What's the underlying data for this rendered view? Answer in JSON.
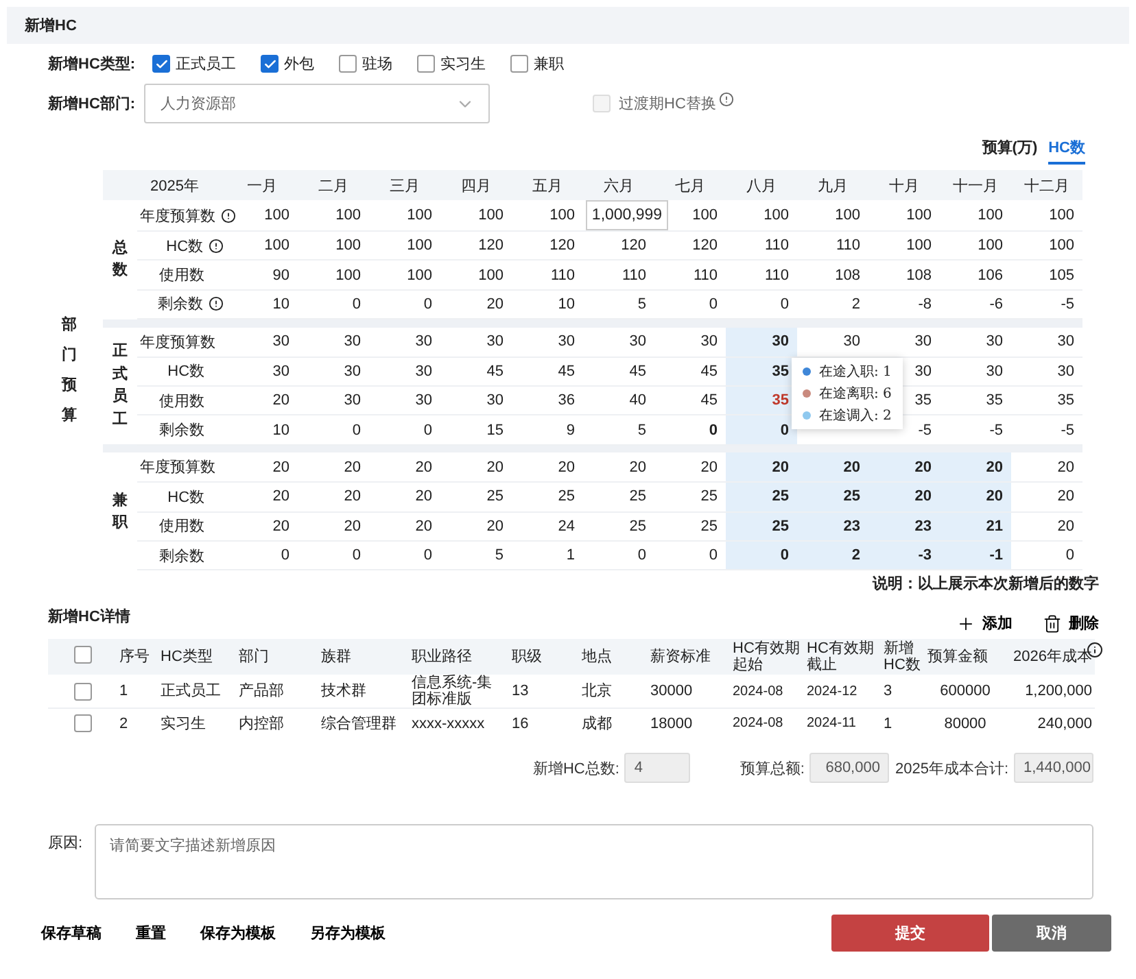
{
  "header": {
    "title": "新增HC"
  },
  "hc_type": {
    "label": "新增HC类型:",
    "options": [
      {
        "label": "正式员工",
        "checked": true
      },
      {
        "label": "外包",
        "checked": true
      },
      {
        "label": "驻场",
        "checked": false
      },
      {
        "label": "实习生",
        "checked": false
      },
      {
        "label": "兼职",
        "checked": false
      }
    ]
  },
  "department": {
    "label": "新增HC部门:",
    "value": "人力资源部",
    "transition": {
      "label": "过渡期HC替换",
      "checked": false,
      "disabled": true
    }
  },
  "view_toggle": [
    {
      "label": "预算(万)",
      "selected": false
    },
    {
      "label": "HC数",
      "selected": true
    }
  ],
  "budget_table": {
    "section_label": "部门预算",
    "year": "2025年",
    "months": [
      "一月",
      "二月",
      "三月",
      "四月",
      "五月",
      "六月",
      "七月",
      "八月",
      "九月",
      "十月",
      "十一月",
      "十二月"
    ],
    "groups": [
      {
        "name": "总数",
        "rows": [
          {
            "label": "年度预算数",
            "info": true,
            "cells": [
              {
                "text": "100",
                "kind": "plain"
              },
              {
                "text": "100",
                "kind": "plain"
              },
              {
                "text": "100",
                "kind": "plain"
              },
              {
                "text": "100",
                "kind": "plain"
              },
              {
                "text": "100",
                "kind": "plain"
              },
              {
                "text": "1,000,999",
                "kind": "input"
              },
              {
                "text": "100",
                "kind": "plain"
              },
              {
                "text": "100",
                "kind": "plain"
              },
              {
                "text": "100",
                "kind": "plain"
              },
              {
                "text": "100",
                "kind": "plain"
              },
              {
                "text": "100",
                "kind": "plain"
              },
              {
                "text": "100",
                "kind": "plain"
              }
            ]
          },
          {
            "label": "HC数",
            "info": true,
            "cells": [
              {
                "text": "100",
                "kind": "plain"
              },
              {
                "text": "100",
                "kind": "plain"
              },
              {
                "text": "100",
                "kind": "plain"
              },
              {
                "text": "120",
                "kind": "plain"
              },
              {
                "text": "120",
                "kind": "plain"
              },
              {
                "text": "120",
                "kind": "plain"
              },
              {
                "text": "120",
                "kind": "plain"
              },
              {
                "text": "110",
                "kind": "plain"
              },
              {
                "text": "110",
                "kind": "plain"
              },
              {
                "text": "100",
                "kind": "plain"
              },
              {
                "text": "100",
                "kind": "plain"
              },
              {
                "text": "100",
                "kind": "plain"
              }
            ]
          },
          {
            "label": "使用数",
            "info": false,
            "cells": [
              {
                "text": "90",
                "kind": "plain"
              },
              {
                "text": "100",
                "kind": "plain"
              },
              {
                "text": "100",
                "kind": "plain"
              },
              {
                "text": "100",
                "kind": "plain"
              },
              {
                "text": "110",
                "kind": "plain"
              },
              {
                "text": "110",
                "kind": "plain"
              },
              {
                "text": "110",
                "kind": "plain"
              },
              {
                "text": "110",
                "kind": "plain"
              },
              {
                "text": "108",
                "kind": "plain"
              },
              {
                "text": "108",
                "kind": "plain"
              },
              {
                "text": "106",
                "kind": "plain"
              },
              {
                "text": "105",
                "kind": "plain"
              }
            ]
          },
          {
            "label": "剩余数",
            "info": true,
            "cells": [
              {
                "text": "10",
                "kind": "plain"
              },
              {
                "text": "0",
                "kind": "plain"
              },
              {
                "text": "0",
                "kind": "plain"
              },
              {
                "text": "20",
                "kind": "plain"
              },
              {
                "text": "10",
                "kind": "plain"
              },
              {
                "text": "5",
                "kind": "plain"
              },
              {
                "text": "0",
                "kind": "plain"
              },
              {
                "text": "0",
                "kind": "plain"
              },
              {
                "text": "2",
                "kind": "plain"
              },
              {
                "text": "-8",
                "kind": "plain"
              },
              {
                "text": "-6",
                "kind": "plain"
              },
              {
                "text": "-5",
                "kind": "plain"
              }
            ]
          }
        ]
      },
      {
        "name": "正式员工",
        "rows": [
          {
            "label": "年度预算数",
            "info": false,
            "cells": [
              {
                "text": "30",
                "kind": "plain"
              },
              {
                "text": "30",
                "kind": "plain"
              },
              {
                "text": "30",
                "kind": "plain"
              },
              {
                "text": "30",
                "kind": "plain"
              },
              {
                "text": "30",
                "kind": "plain"
              },
              {
                "text": "30",
                "kind": "plain"
              },
              {
                "text": "30",
                "kind": "plain"
              },
              {
                "text": "30",
                "kind": "highlight"
              },
              {
                "text": "30",
                "kind": "plain"
              },
              {
                "text": "30",
                "kind": "plain"
              },
              {
                "text": "30",
                "kind": "plain"
              },
              {
                "text": "30",
                "kind": "plain"
              }
            ]
          },
          {
            "label": "HC数",
            "info": false,
            "cells": [
              {
                "text": "30",
                "kind": "plain"
              },
              {
                "text": "30",
                "kind": "plain"
              },
              {
                "text": "30",
                "kind": "plain"
              },
              {
                "text": "45",
                "kind": "plain"
              },
              {
                "text": "45",
                "kind": "plain"
              },
              {
                "text": "45",
                "kind": "plain"
              },
              {
                "text": "45",
                "kind": "plain"
              },
              {
                "text": "35",
                "kind": "highlight"
              },
              null,
              {
                "text": "30",
                "kind": "plain"
              },
              {
                "text": "30",
                "kind": "plain"
              },
              {
                "text": "30",
                "kind": "plain"
              }
            ]
          },
          {
            "label": "使用数",
            "info": false,
            "cells": [
              {
                "text": "20",
                "kind": "plain"
              },
              {
                "text": "30",
                "kind": "plain"
              },
              {
                "text": "30",
                "kind": "plain"
              },
              {
                "text": "30",
                "kind": "plain"
              },
              {
                "text": "36",
                "kind": "plain"
              },
              {
                "text": "40",
                "kind": "plain"
              },
              {
                "text": "45",
                "kind": "plain"
              },
              {
                "text": "35",
                "kind": "alert"
              },
              null,
              {
                "text": "35",
                "kind": "plain"
              },
              {
                "text": "35",
                "kind": "plain"
              },
              {
                "text": "35",
                "kind": "plain"
              }
            ]
          },
          {
            "label": "剩余数",
            "info": false,
            "cells": [
              {
                "text": "10",
                "kind": "plain"
              },
              {
                "text": "0",
                "kind": "plain"
              },
              {
                "text": "0",
                "kind": "plain"
              },
              {
                "text": "15",
                "kind": "plain"
              },
              {
                "text": "9",
                "kind": "plain"
              },
              {
                "text": "5",
                "kind": "plain"
              },
              {
                "text": "0",
                "kind": "bold"
              },
              {
                "text": "0",
                "kind": "highlight"
              },
              null,
              {
                "text": "-5",
                "kind": "plain"
              },
              {
                "text": "-5",
                "kind": "plain"
              },
              {
                "text": "-5",
                "kind": "plain"
              }
            ]
          }
        ],
        "popup": [
          {
            "label": "在途入职: 1",
            "color": "#3f87d8"
          },
          {
            "label": "在途离职: 6",
            "color": "#c98a7e"
          },
          {
            "label": "在途调入: 2",
            "color": "#8fc9ef"
          }
        ]
      },
      {
        "name": "兼职",
        "rows": [
          {
            "label": "年度预算数",
            "info": false,
            "cells": [
              {
                "text": "20",
                "kind": "plain"
              },
              {
                "text": "20",
                "kind": "plain"
              },
              {
                "text": "20",
                "kind": "plain"
              },
              {
                "text": "20",
                "kind": "plain"
              },
              {
                "text": "20",
                "kind": "plain"
              },
              {
                "text": "20",
                "kind": "plain"
              },
              {
                "text": "20",
                "kind": "plain"
              },
              {
                "text": "20",
                "kind": "highlight"
              },
              {
                "text": "20",
                "kind": "highlight"
              },
              {
                "text": "20",
                "kind": "highlight"
              },
              {
                "text": "20",
                "kind": "highlight"
              },
              {
                "text": "20",
                "kind": "plain"
              }
            ]
          },
          {
            "label": "HC数",
            "info": false,
            "cells": [
              {
                "text": "20",
                "kind": "plain"
              },
              {
                "text": "20",
                "kind": "plain"
              },
              {
                "text": "20",
                "kind": "plain"
              },
              {
                "text": "25",
                "kind": "plain"
              },
              {
                "text": "25",
                "kind": "plain"
              },
              {
                "text": "25",
                "kind": "plain"
              },
              {
                "text": "25",
                "kind": "plain"
              },
              {
                "text": "25",
                "kind": "highlight"
              },
              {
                "text": "25",
                "kind": "highlight"
              },
              {
                "text": "20",
                "kind": "highlight"
              },
              {
                "text": "20",
                "kind": "highlight"
              },
              {
                "text": "20",
                "kind": "plain"
              }
            ]
          },
          {
            "label": "使用数",
            "info": false,
            "cells": [
              {
                "text": "20",
                "kind": "plain"
              },
              {
                "text": "20",
                "kind": "plain"
              },
              {
                "text": "20",
                "kind": "plain"
              },
              {
                "text": "20",
                "kind": "plain"
              },
              {
                "text": "24",
                "kind": "plain"
              },
              {
                "text": "25",
                "kind": "plain"
              },
              {
                "text": "25",
                "kind": "plain"
              },
              {
                "text": "25",
                "kind": "highlight"
              },
              {
                "text": "23",
                "kind": "highlight"
              },
              {
                "text": "23",
                "kind": "highlight"
              },
              {
                "text": "21",
                "kind": "highlight"
              },
              {
                "text": "20",
                "kind": "plain"
              }
            ]
          },
          {
            "label": "剩余数",
            "info": false,
            "cells": [
              {
                "text": "0",
                "kind": "plain"
              },
              {
                "text": "0",
                "kind": "plain"
              },
              {
                "text": "0",
                "kind": "plain"
              },
              {
                "text": "5",
                "kind": "plain"
              },
              {
                "text": "1",
                "kind": "plain"
              },
              {
                "text": "0",
                "kind": "plain"
              },
              {
                "text": "0",
                "kind": "plain"
              },
              {
                "text": "0",
                "kind": "highlight"
              },
              {
                "text": "2",
                "kind": "highlight"
              },
              {
                "text": "-3",
                "kind": "highlight"
              },
              {
                "text": "-1",
                "kind": "highlight"
              },
              {
                "text": "0",
                "kind": "plain"
              }
            ]
          }
        ]
      }
    ]
  },
  "note": "说明：以上展示本次新增后的数字",
  "details": {
    "title": "新增HC详情",
    "actions": [
      {
        "kind": "add",
        "label": "添加"
      },
      {
        "kind": "delete",
        "label": "删除"
      }
    ],
    "select_all_checked": false,
    "columns": [
      {
        "label": "序号",
        "info": false
      },
      {
        "label": "HC类型",
        "info": false
      },
      {
        "label": "部门",
        "info": false
      },
      {
        "label": "族群",
        "info": false
      },
      {
        "label": "职业路径",
        "info": false
      },
      {
        "label": "职级",
        "info": false
      },
      {
        "label": "地点",
        "info": false
      },
      {
        "label": "薪资标准",
        "info": false
      },
      {
        "label": "HC有效期起始",
        "info": false
      },
      {
        "label": "HC有效期截止",
        "info": false
      },
      {
        "label": "新增HC数",
        "info": false
      },
      {
        "label": "预算金额",
        "info": false
      },
      {
        "label": "2026年成本",
        "info": true
      }
    ],
    "rows": [
      {
        "checked": false,
        "cells": [
          "1",
          "正式员工",
          "产品部",
          "技术群",
          "信息系统-集团标准版",
          "13",
          "北京",
          "30000",
          "2024-08",
          "2024-12",
          "3",
          "600000",
          "1,200,000"
        ]
      },
      {
        "checked": false,
        "cells": [
          "2",
          "实习生",
          "内控部",
          "综合管理群",
          "xxxx-xxxxx",
          "16",
          "成都",
          "18000",
          "2024-08",
          "2024-11",
          "1",
          "80000",
          "240,000"
        ]
      }
    ],
    "totals": [
      {
        "label": "新增HC总数:",
        "value": "4"
      },
      {
        "label": "预算总额:",
        "value": "680,000"
      },
      {
        "label": "2025年成本合计:",
        "value": "1,440,000"
      }
    ]
  },
  "reason": {
    "label": "原因:",
    "placeholder": "请简要文字描述新增原因"
  },
  "footer": {
    "links": [
      "保存草稿",
      "重置",
      "保存为模板",
      "另存为模板"
    ],
    "buttons": [
      {
        "kind": "primary",
        "label": "提交"
      },
      {
        "kind": "secondary",
        "label": "取消"
      }
    ]
  }
}
